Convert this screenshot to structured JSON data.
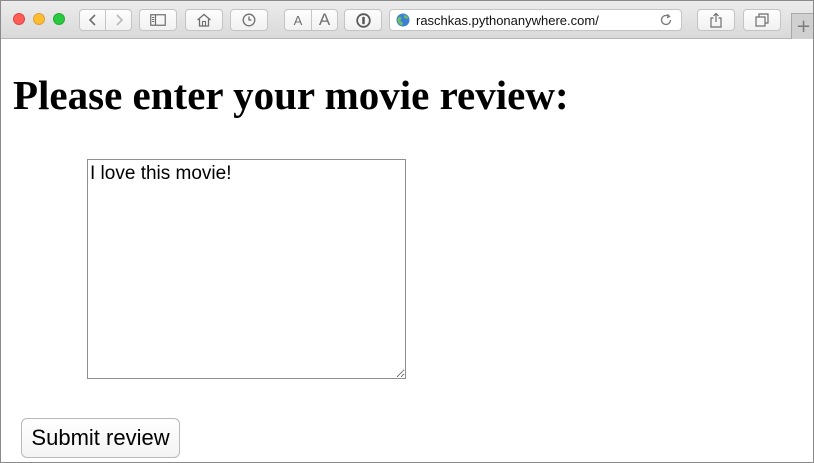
{
  "browser": {
    "url": "raschkas.pythonanywhere.com/",
    "text_size_small_label": "A",
    "text_size_large_label": "A",
    "new_tab_label": "+",
    "icons": {
      "back": "chevron-left-icon",
      "forward": "chevron-right-icon",
      "sidebar": "sidebar-icon",
      "home": "home-icon",
      "history": "clock-icon",
      "password": "keyhole-icon",
      "site": "globe-icon",
      "reload": "reload-icon",
      "share": "share-icon",
      "tabs": "tabs-overview-icon"
    },
    "colors": {
      "close": "#fc5d57",
      "minimize": "#fdbc2f",
      "zoom": "#28c840"
    }
  },
  "page": {
    "heading": "Please enter your movie review:",
    "review_text": "I love this movie!",
    "submit_label": "Submit review"
  }
}
